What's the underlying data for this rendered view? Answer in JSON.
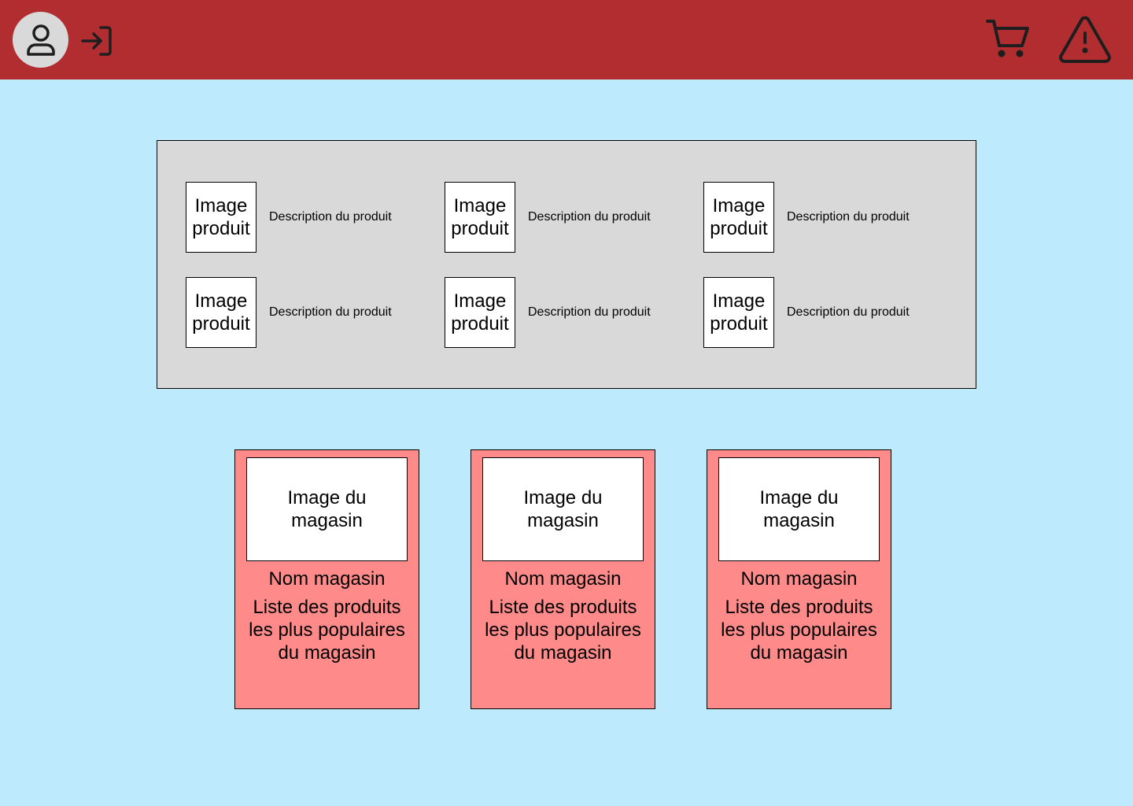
{
  "colors": {
    "header": "#b12d30",
    "background": "#bdeafc",
    "panel": "#d9d9d9",
    "store_card": "#ff8a8a"
  },
  "header": {
    "icons": [
      "user-icon",
      "login-icon",
      "cart-icon",
      "warning-icon"
    ]
  },
  "products": [
    {
      "image_label": "Image produit",
      "description": "Description du produit"
    },
    {
      "image_label": "Image produit",
      "description": "Description du produit"
    },
    {
      "image_label": "Image produit",
      "description": "Description du produit"
    },
    {
      "image_label": "Image produit",
      "description": "Description du produit"
    },
    {
      "image_label": "Image produit",
      "description": "Description du produit"
    },
    {
      "image_label": "Image produit",
      "description": "Description du produit"
    }
  ],
  "stores": [
    {
      "image_label": "Image du magasin",
      "name": "Nom magasin",
      "popular": "Liste des produits les plus populaires du magasin"
    },
    {
      "image_label": "Image du magasin",
      "name": "Nom magasin",
      "popular": "Liste des produits les plus populaires du magasin"
    },
    {
      "image_label": "Image du magasin",
      "name": "Nom magasin",
      "popular": "Liste des produits les plus populaires du magasin"
    }
  ]
}
